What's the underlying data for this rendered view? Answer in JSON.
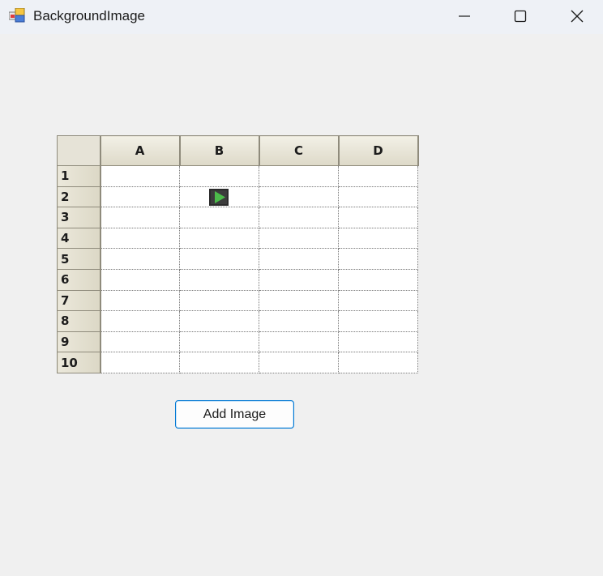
{
  "window": {
    "title": "BackgroundImage",
    "icons": {
      "app": "app-icon",
      "minimize": "minimize-icon",
      "maximize": "maximize-icon",
      "close": "close-icon"
    }
  },
  "grid": {
    "columns": [
      "A",
      "B",
      "C",
      "D"
    ],
    "rows": [
      "1",
      "2",
      "3",
      "4",
      "5",
      "6",
      "7",
      "8",
      "9",
      "10"
    ],
    "image_cell": {
      "row": "2",
      "column": "B",
      "icon": "play-icon",
      "color": "#4cbb4a"
    }
  },
  "actions": {
    "add_image_label": "Add Image"
  }
}
